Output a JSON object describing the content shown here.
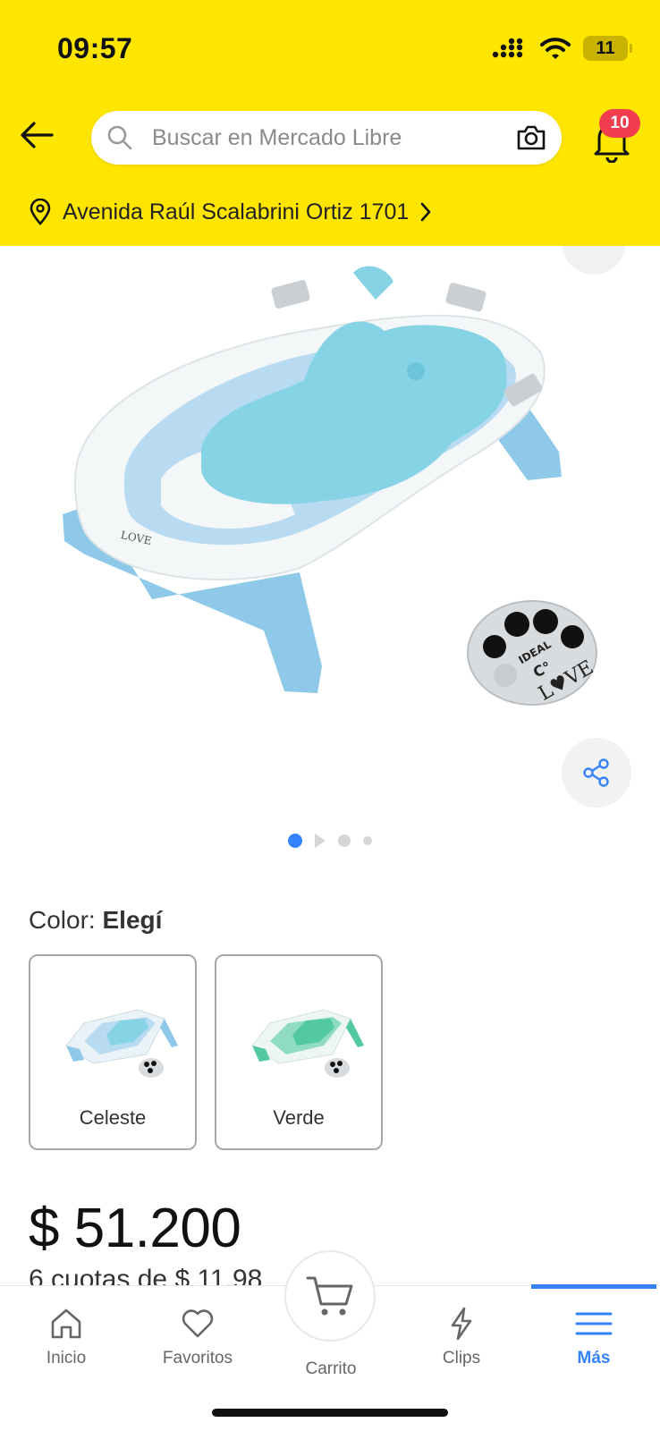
{
  "status_bar": {
    "time": "09:57",
    "battery": "11"
  },
  "header": {
    "search": {
      "placeholder": "Buscar en Mercado Libre",
      "value": ""
    },
    "notifications_count": "10",
    "address": "Avenida Raúl Scalabrini Ortiz 1701"
  },
  "product": {
    "gallery": {
      "image_count": 4,
      "active_index": 0,
      "second_is_video": true
    },
    "color": {
      "label": "Color:",
      "value": "Elegí"
    },
    "variants": [
      {
        "name": "Celeste",
        "accent": "#6FC6DF"
      },
      {
        "name": "Verde",
        "accent": "#52C9A0"
      }
    ],
    "price": "$ 51.200",
    "installments": "6 cuotas de $ 11.98"
  },
  "bottom_nav": {
    "items": [
      {
        "label": "Inicio",
        "icon": "home-icon"
      },
      {
        "label": "Favoritos",
        "icon": "heart-icon"
      },
      {
        "label": "Carrito",
        "icon": "cart-icon"
      },
      {
        "label": "Clips",
        "icon": "bolt-icon"
      },
      {
        "label": "Más",
        "icon": "menu-icon"
      }
    ],
    "active": "Más"
  },
  "colors": {
    "brand_yellow": "#FFE600",
    "accent_blue": "#3483FA",
    "badge_red": "#F23D4F"
  }
}
